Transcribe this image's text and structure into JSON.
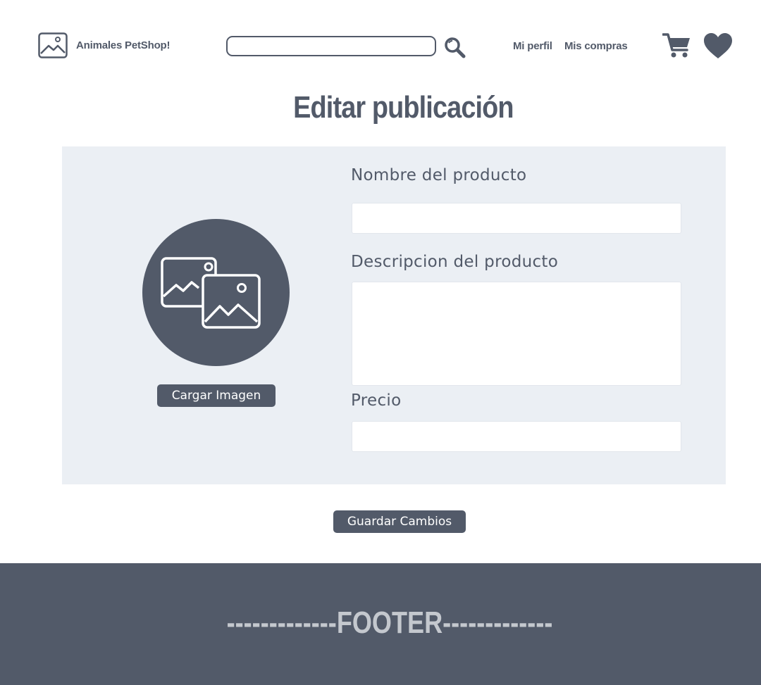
{
  "header": {
    "logo_icon": "image-icon",
    "brand_name": "Animales PetShop!",
    "search": {
      "placeholder": "",
      "value": "",
      "icon": "search-icon"
    },
    "nav": {
      "profile_label": "Mi perfil",
      "purchases_label": "Mis compras"
    },
    "cart_icon": "cart-icon",
    "favorites_icon": "heart-icon"
  },
  "page": {
    "title": "Editar publicación"
  },
  "form": {
    "image_icon": "images-icon",
    "upload_label": "Cargar Imagen",
    "name_label": "Nombre del producto",
    "name_value": "",
    "description_label": "Descripcion del producto",
    "description_value": "",
    "price_label": "Precio",
    "price_value": "",
    "save_label": "Guardar Cambios"
  },
  "footer": {
    "text": "-------------FOOTER-------------"
  },
  "colors": {
    "primary": "#525a69",
    "panel": "#ebeff4",
    "footer_text": "#c4c8ce",
    "background": "#ffffff"
  }
}
